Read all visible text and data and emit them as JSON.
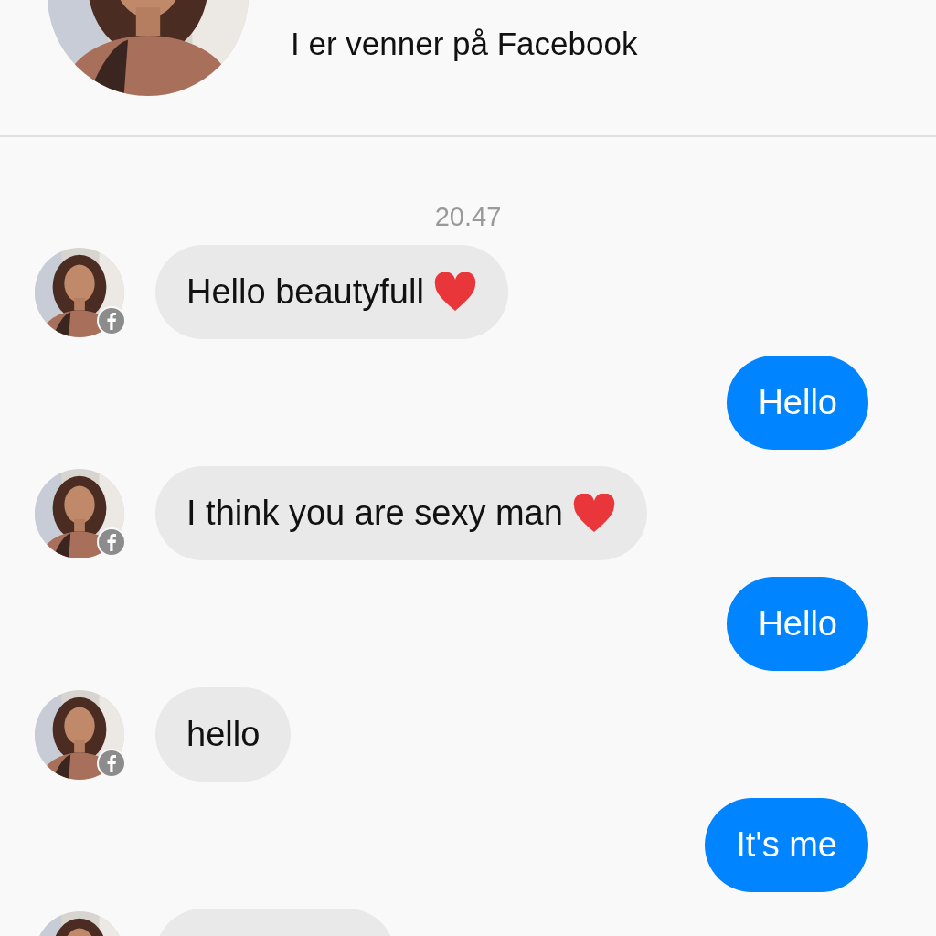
{
  "header": {
    "subtitle": "I er venner på Facebook"
  },
  "timestamp": "20.47",
  "messages": [
    {
      "kind": "incoming",
      "text": "Hello beautyfull",
      "heart": true,
      "badge": true
    },
    {
      "kind": "outgoing",
      "text": "Hello"
    },
    {
      "kind": "incoming",
      "text": "I think you are sexy man",
      "heart": true,
      "badge": true
    },
    {
      "kind": "outgoing",
      "text": "Hello"
    },
    {
      "kind": "incoming",
      "text": "hello",
      "heart": false,
      "badge": true
    },
    {
      "kind": "outgoing",
      "text": "It's me"
    },
    {
      "kind": "incoming"
    }
  ]
}
